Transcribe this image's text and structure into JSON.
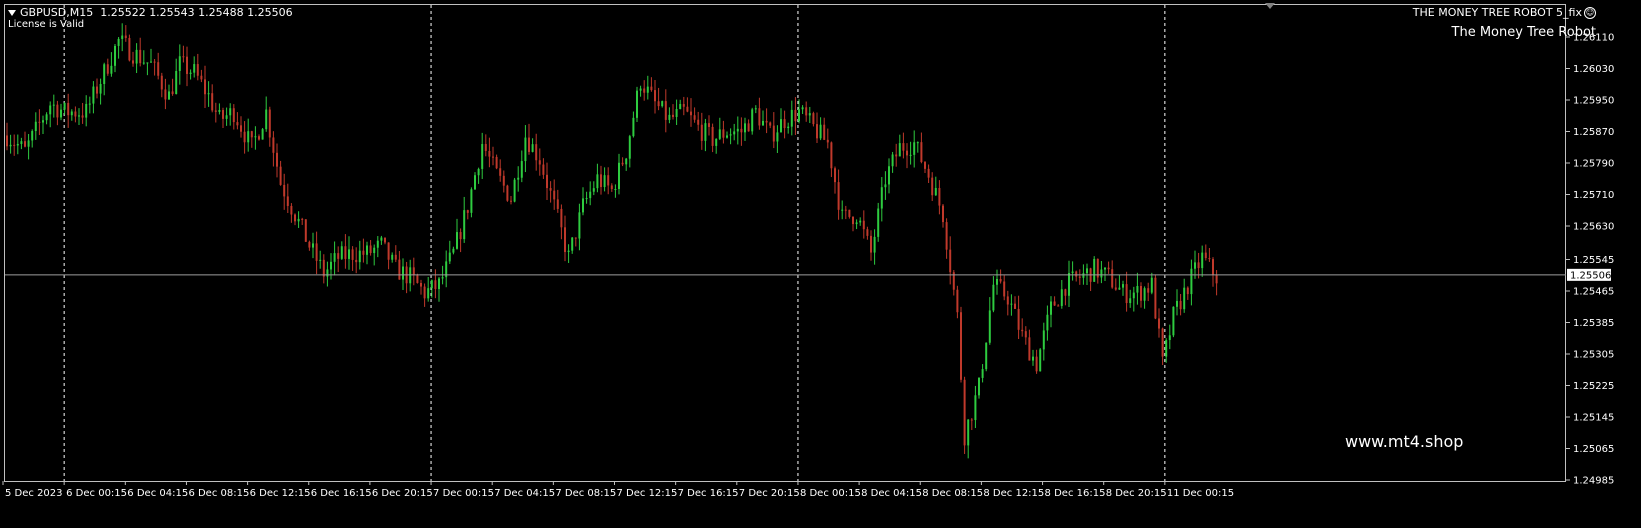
{
  "header": {
    "symbol": "GBPUSD,M15",
    "ohlc": "1.25522 1.25543 1.25488 1.25506",
    "license": "License is Valid"
  },
  "indicator": {
    "name": "THE MONEY TREE ROBOT 5_fix",
    "label": "The Money Tree Robot"
  },
  "watermark": "www.mt4.shop",
  "colors": {
    "background": "#000000",
    "bull": "#2ecc40",
    "bear": "#c0392b",
    "grid": "#ffffff",
    "price_line": "#9e9e9e"
  },
  "chart_data": {
    "type": "candlestick",
    "timeframe": "M15",
    "ylim": [
      1.24985,
      1.2615
    ],
    "price_ticks": [
      "1.26110",
      "1.26030",
      "1.25950",
      "1.25870",
      "1.25790",
      "1.25710",
      "1.25630",
      "1.25545",
      "1.25465",
      "1.25385",
      "1.25305",
      "1.25225",
      "1.25145",
      "1.25065",
      "1.24985"
    ],
    "current_price": "1.25506",
    "time_labels": [
      "5 Dec 2023",
      "6 Dec 00:15",
      "6 Dec 04:15",
      "6 Dec 08:15",
      "6 Dec 12:15",
      "6 Dec 16:15",
      "6 Dec 20:15",
      "7 Dec 00:15",
      "7 Dec 04:15",
      "7 Dec 08:15",
      "7 Dec 12:15",
      "7 Dec 16:15",
      "7 Dec 20:15",
      "8 Dec 00:15",
      "8 Dec 04:15",
      "8 Dec 08:15",
      "8 Dec 12:15",
      "8 Dec 16:15",
      "8 Dec 20:15",
      "11 Dec 00:15"
    ],
    "day_separators_after_label": [
      "6 Dec 00:15",
      "7 Dec 00:15",
      "8 Dec 00:15",
      "11 Dec 00:15"
    ],
    "close_path": [
      [
        0,
        1.2586
      ],
      [
        5,
        1.2582
      ],
      [
        12,
        1.2594
      ],
      [
        16,
        1.2592
      ],
      [
        22,
        1.2592
      ],
      [
        28,
        1.2604
      ],
      [
        31,
        1.261
      ],
      [
        35,
        1.2607
      ],
      [
        40,
        1.2604
      ],
      [
        45,
        1.2596
      ],
      [
        48,
        1.2604
      ],
      [
        52,
        1.2602
      ],
      [
        56,
        1.2596
      ],
      [
        59,
        1.259
      ],
      [
        63,
        1.2592
      ],
      [
        68,
        1.2583
      ],
      [
        72,
        1.2592
      ],
      [
        76,
        1.2574
      ],
      [
        80,
        1.2566
      ],
      [
        84,
        1.2558
      ],
      [
        88,
        1.2551
      ],
      [
        92,
        1.2555
      ],
      [
        96,
        1.2556
      ],
      [
        100,
        1.2556
      ],
      [
        104,
        1.2558
      ],
      [
        108,
        1.2552
      ],
      [
        112,
        1.255
      ],
      [
        116,
        1.2546
      ],
      [
        120,
        1.2548
      ],
      [
        124,
        1.2556
      ],
      [
        128,
        1.2568
      ],
      [
        132,
        1.2584
      ],
      [
        136,
        1.2576
      ],
      [
        140,
        1.257
      ],
      [
        144,
        1.2586
      ],
      [
        148,
        1.258
      ],
      [
        152,
        1.2568
      ],
      [
        156,
        1.2555
      ],
      [
        160,
        1.2568
      ],
      [
        164,
        1.2575
      ],
      [
        168,
        1.2572
      ],
      [
        172,
        1.2582
      ],
      [
        176,
        1.26
      ],
      [
        180,
        1.2594
      ],
      [
        184,
        1.259
      ],
      [
        188,
        1.2592
      ],
      [
        192,
        1.2588
      ],
      [
        196,
        1.2585
      ],
      [
        200,
        1.2587
      ],
      [
        204,
        1.2587
      ],
      [
        208,
        1.2592
      ],
      [
        212,
        1.2586
      ],
      [
        216,
        1.259
      ],
      [
        220,
        1.2592
      ],
      [
        224,
        1.2588
      ],
      [
        228,
        1.2584
      ],
      [
        232,
        1.2565
      ],
      [
        236,
        1.2566
      ],
      [
        240,
        1.2556
      ],
      [
        244,
        1.2575
      ],
      [
        248,
        1.2583
      ],
      [
        252,
        1.2584
      ],
      [
        256,
        1.2576
      ],
      [
        260,
        1.2566
      ],
      [
        264,
        1.254
      ],
      [
        266,
        1.251
      ],
      [
        270,
        1.2522
      ],
      [
        274,
        1.2548
      ],
      [
        278,
        1.2545
      ],
      [
        282,
        1.2535
      ],
      [
        286,
        1.2528
      ],
      [
        290,
        1.2542
      ],
      [
        294,
        1.2548
      ],
      [
        298,
        1.255
      ],
      [
        302,
        1.2552
      ],
      [
        306,
        1.255
      ],
      [
        310,
        1.2546
      ],
      [
        314,
        1.2546
      ],
      [
        318,
        1.2548
      ],
      [
        321,
        1.2528
      ],
      [
        324,
        1.254
      ],
      [
        328,
        1.2548
      ],
      [
        332,
        1.2555
      ],
      [
        336,
        1.255
      ]
    ]
  }
}
